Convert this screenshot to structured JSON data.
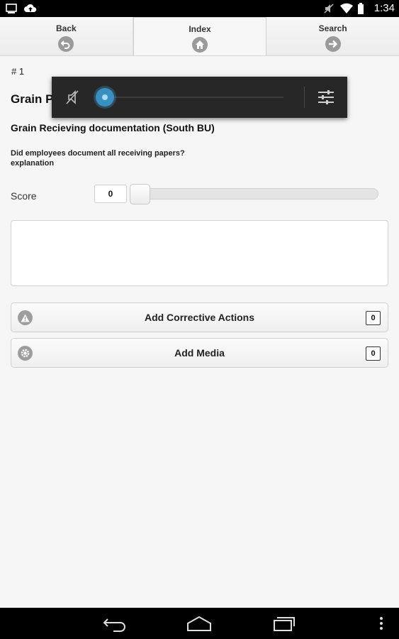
{
  "status_bar": {
    "time": "1:34",
    "left_icons": [
      "screenshot-icon",
      "cloud-upload-icon"
    ],
    "right_icons": [
      "volume-muted-icon",
      "wifi-icon",
      "battery-icon"
    ]
  },
  "tabs": [
    {
      "label": "Back",
      "icon": "back-arrow-icon"
    },
    {
      "label": "Index",
      "icon": "home-icon"
    },
    {
      "label": "Search",
      "icon": "forward-arrow-icon"
    }
  ],
  "item_number": "# 1",
  "page_title": "Grain P",
  "subtitle": "Grain Recieving documentation (South BU)",
  "question": {
    "line1": "Did employees document all receiving papers?",
    "line2": "explanation"
  },
  "score": {
    "label": "Score",
    "value": "0",
    "slider_fraction": 0
  },
  "explanation_text": "",
  "actions": {
    "corrective": {
      "label": "Add Corrective Actions",
      "count": "0",
      "icon": "warning-icon"
    },
    "media": {
      "label": "Add Media",
      "count": "0",
      "icon": "gear-icon"
    }
  },
  "volume_overlay": {
    "level_fraction": 0,
    "accent": "#3a8fc1",
    "icons": [
      "volume-muted-icon",
      "equalizer-settings-icon"
    ]
  },
  "nav_bar": {
    "buttons": [
      "back-nav-icon",
      "home-nav-icon",
      "recent-apps-icon",
      "overflow-menu-icon"
    ]
  }
}
